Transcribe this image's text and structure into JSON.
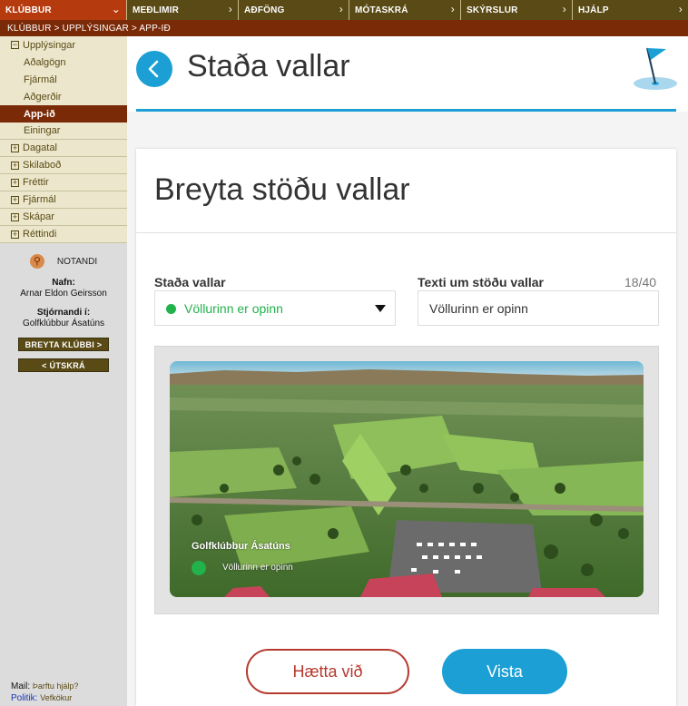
{
  "topnav": [
    {
      "label": "KLÚBBUR",
      "active": true
    },
    {
      "label": "MEÐLIMIR"
    },
    {
      "label": "AÐFÖNG"
    },
    {
      "label": "MÓTASKRÁ"
    },
    {
      "label": "SKÝRSLUR"
    },
    {
      "label": "HJÁLP"
    }
  ],
  "breadcrumb": "KLÚBBUR > UPPLÝSINGAR > APP-IÐ",
  "sidebar": {
    "menu": [
      {
        "label": "Upplýsingar",
        "toggle": "−"
      },
      {
        "label": "Aðalgögn"
      },
      {
        "label": "Fjármál"
      },
      {
        "label": "Aðgerðir"
      },
      {
        "label": "App-ið"
      },
      {
        "label": "Einingar"
      },
      {
        "label": "Dagatal",
        "toggle": "+"
      },
      {
        "label": "Skilaboð",
        "toggle": "+"
      },
      {
        "label": "Fréttir",
        "toggle": "+"
      },
      {
        "label": "Fjármál",
        "toggle": "+"
      },
      {
        "label": "Skápar",
        "toggle": "+"
      },
      {
        "label": "Réttindi",
        "toggle": "+"
      }
    ],
    "user": {
      "heading": "NOTANDI",
      "name_label": "Nafn:",
      "name": "Arnar Eldon Geirsson",
      "admin_label": "Stjórnandi í:",
      "club": "Golfklúbbur Ásatúns",
      "change_club_button": "BREYTA KLÚBBI >",
      "logout_button": "< ÚTSKRÁ"
    },
    "footer": {
      "mail_label": "Mail:",
      "mail_text": "Þarftu hjálp?",
      "policy_label": "Politik:",
      "policy_text": "Vefkökur"
    }
  },
  "main": {
    "title": "Staða vallar",
    "card_title": "Breyta stöðu vallar",
    "status_label": "Staða vallar",
    "status_value": "Völlurinn er opinn",
    "status_color": "#21b24b",
    "text_label": "Texti um stöðu vallar",
    "text_counter": "18/40",
    "text_value": "Völlurinn er opinn",
    "preview": {
      "club_name": "Golfklúbbur Ásatúns",
      "status_text": "Völlurinn er opinn"
    },
    "cancel_button": "Hætta við",
    "save_button": "Vista"
  },
  "colors": {
    "accent": "#1b9fd4",
    "nav_bg": "#5a4a15",
    "nav_active": "#b53a0e",
    "crumb_bg": "#7b2a08",
    "cancel": "#b53a2e"
  }
}
